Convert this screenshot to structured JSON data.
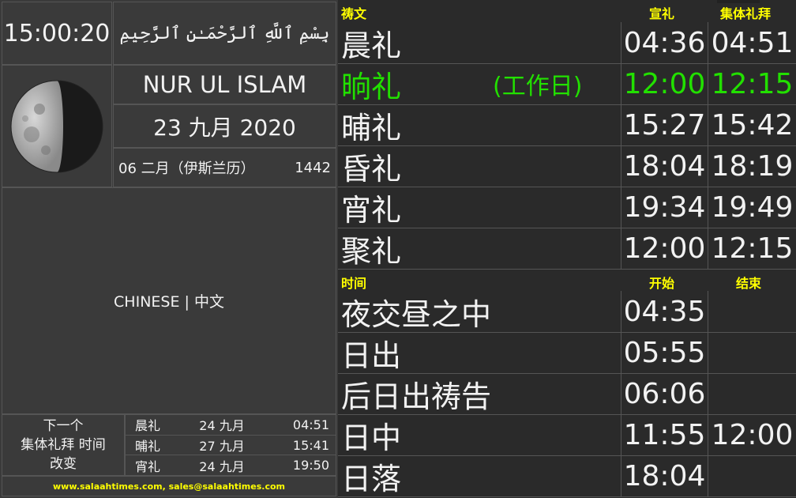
{
  "header": {
    "clock": "15:00:20",
    "bismillah": "بِسْمِ ٱللَّهِ ٱلرَّحْمَـٰنِ ٱلرَّحِيمِ"
  },
  "mosque_name": "NUR UL ISLAM",
  "gregorian_date": "23 九月 2020",
  "hijri": {
    "date": "06 二月（伊斯兰历）",
    "year": "1442"
  },
  "language_label": "CHINESE | 中文",
  "next_change": {
    "label_lines": [
      "下一个",
      "集体礼拜 时间",
      "改变"
    ],
    "rows": [
      {
        "name": "晨礼",
        "date": "24 九月",
        "time": "04:51"
      },
      {
        "name": "晡礼",
        "date": "27 九月",
        "time": "15:41"
      },
      {
        "name": "宵礼",
        "date": "24 九月",
        "time": "19:50"
      }
    ]
  },
  "footer": "www.salaahtimes.com, sales@salaahtimes.com",
  "prayer_table": {
    "headers": {
      "name": "祷文",
      "adhan": "宣礼",
      "iqamah": "集体礼拜"
    },
    "workday_note": "(工作日)",
    "rows": [
      {
        "name": "晨礼",
        "adhan": "04:36",
        "iqamah": "04:51"
      },
      {
        "name": "晌礼",
        "adhan": "12:00",
        "iqamah": "12:15"
      },
      {
        "name": "晡礼",
        "adhan": "15:27",
        "iqamah": "15:42"
      },
      {
        "name": "昏礼",
        "adhan": "18:04",
        "iqamah": "18:19"
      },
      {
        "name": "宵礼",
        "adhan": "19:34",
        "iqamah": "19:49"
      },
      {
        "name": "聚礼",
        "adhan": "12:00",
        "iqamah": "12:15"
      }
    ]
  },
  "times_table": {
    "headers": {
      "name": "时间",
      "start": "开始",
      "end": "结束"
    },
    "rows": [
      {
        "name": "夜交昼之中",
        "start": "04:35",
        "end": ""
      },
      {
        "name": "日出",
        "start": "05:55",
        "end": ""
      },
      {
        "name": "后日出祷告",
        "start": "06:06",
        "end": ""
      },
      {
        "name": "日中",
        "start": "11:55",
        "end": "12:00"
      },
      {
        "name": "日落",
        "start": "18:04",
        "end": ""
      }
    ]
  },
  "colors": {
    "accent": "#ffff00",
    "active": "#22e000",
    "background": "#3a3a3a"
  },
  "icons": {
    "moon": "moon-phase-icon"
  }
}
